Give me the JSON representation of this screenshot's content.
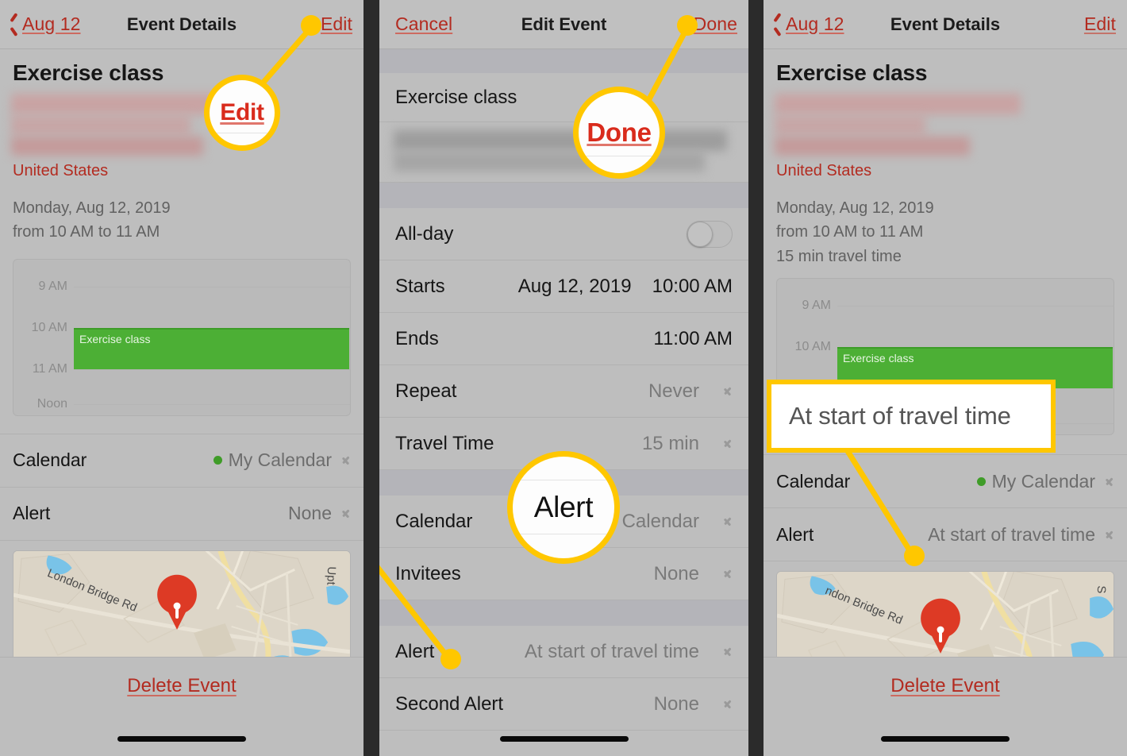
{
  "panels": [
    {
      "id": "event-details-before",
      "nav": {
        "back_label": "Aug 12",
        "title": "Event Details",
        "action_label": "Edit"
      },
      "event": {
        "title": "Exercise class",
        "country": "United States",
        "date_line": "Monday, Aug 12, 2019",
        "time_line": "from 10 AM to 11 AM",
        "travel_line": ""
      },
      "rows": [
        {
          "label": "Calendar",
          "value": "My Calendar",
          "dot": true
        },
        {
          "label": "Alert",
          "value": "None",
          "dot": false
        }
      ],
      "map": {
        "street_1": "London Bridge Rd",
        "street_2": "Upt"
      },
      "footer": {
        "delete_label": "Delete Event"
      }
    },
    {
      "id": "edit-event",
      "nav": {
        "back_label": "Cancel",
        "title": "Edit Event",
        "action_label": "Done"
      },
      "title_field": "Exercise class",
      "fields": [
        {
          "label": "All-day",
          "value": "",
          "type": "toggle",
          "toggle_on": false
        },
        {
          "label": "Starts",
          "value": "Aug 12, 2019",
          "value2": "10:00 AM",
          "type": "datetime"
        },
        {
          "label": "Ends",
          "value": "11:00 AM",
          "type": "datetime"
        },
        {
          "label": "Repeat",
          "value": "Never",
          "type": "disclosure"
        },
        {
          "label": "Travel Time",
          "value": "15 min",
          "type": "disclosure"
        },
        {
          "label": "Calendar",
          "value": "My Calendar",
          "type": "disclosure"
        },
        {
          "label": "Invitees",
          "value": "None",
          "type": "disclosure"
        },
        {
          "label": "Alert",
          "value": "At start of travel time",
          "type": "disclosure"
        },
        {
          "label": "Second Alert",
          "value": "None",
          "type": "disclosure"
        }
      ]
    },
    {
      "id": "event-details-after",
      "nav": {
        "back_label": "Aug 12",
        "title": "Event Details",
        "action_label": "Edit"
      },
      "event": {
        "title": "Exercise class",
        "country": "United States",
        "date_line": "Monday, Aug 12, 2019",
        "time_line": "from 10 AM to 11 AM",
        "travel_line": "15 min travel time"
      },
      "rows": [
        {
          "label": "Calendar",
          "value": "My Calendar",
          "dot": true
        },
        {
          "label": "Alert",
          "value": "At start of travel time",
          "dot": false
        }
      ],
      "map": {
        "street_1": "ndon Bridge Rd",
        "street_2": "S"
      },
      "footer": {
        "delete_label": "Delete Event"
      }
    }
  ],
  "mini_calendar": {
    "labels": [
      "9 AM",
      "10 AM",
      "11 AM",
      "Noon"
    ],
    "event_label": "Exercise class",
    "event_start": "10 AM",
    "event_end": "11 AM",
    "event_color": "#4caf35"
  },
  "callouts": [
    {
      "id": "edit-bubble",
      "text": "Edit",
      "style": "red"
    },
    {
      "id": "done-bubble",
      "text": "Done",
      "style": "red"
    },
    {
      "id": "alert-bubble",
      "text": "Alert",
      "style": "black"
    },
    {
      "id": "travel-time-box",
      "text": "At start of travel time",
      "style": "box"
    }
  ],
  "colors": {
    "accent_yellow": "#ffc700",
    "link_red": "#b32b20",
    "callout_red": "#d92b1c",
    "calendar_green": "#4caf35",
    "panel_bg": "#bebebe",
    "gutter": "#2b2b2b"
  }
}
